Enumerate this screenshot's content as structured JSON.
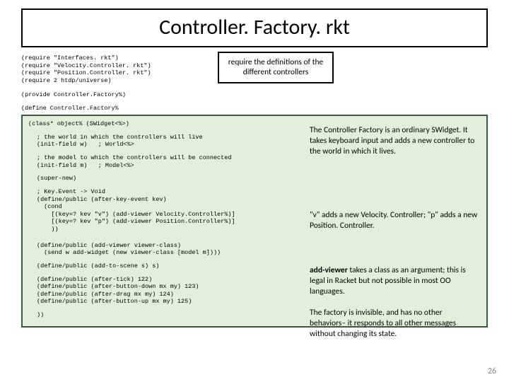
{
  "title": "Controller. Factory. rkt",
  "requires": "(require \"Interfaces. rkt\")\n(require \"Velocity.Controller. rkt\")\n(require \"Position.Controller. rkt\")\n(require 2 htdp/universe)",
  "provide": "(provide Controller.Factory%)",
  "define_open": "(define Controller.Factory%",
  "class_open": "(class* object% (SWidget<%>)",
  "world_comment": "; the world in which the controllers will live\n(init-field w)   ; World<%>",
  "model_comment": "; the model to which the controllers will be connected\n(init-field m)   ; Model<%>",
  "super_new": "(super-new)",
  "key_event": "; Key.Event -> Void\n(define/public (after-key-event kev)\n  (cond\n    [(key=? kev \"v\") (add-viewer Velocity.Controller%)]\n    [(key=? kev \"p\") (add-viewer Position.Controller%)]\n    ))",
  "add_viewer": "(define/public (add-viewer viewer-class)\n  (send w add-widget (new viewer-class [model m])))",
  "add_to_scene": "(define/public (add-to-scene s) s)",
  "afters": "(define/public (after-tick) 122)\n(define/public (after-button-down mx my) 123)\n(define/public (after-drag mx my) 124)\n(define/public (after-button-up mx my) 125)",
  "close": "))",
  "note_requires": "require the definitions of the different controllers",
  "note_factory": "The Controller Factory is an ordinary SWidget. It takes keyboard input and adds a new controller to the world in which it lives.",
  "note_keys": "\"v\" adds a new Velocity. Controller; \"p\" adds a new Position. Controller.",
  "note_addviewer_prefix": "add-viewer",
  "note_addviewer_rest": " takes a class as an argument; this is legal in Racket but not possible in most OO languages.",
  "note_invisible": "The factory is invisible, and has no other behaviors– it responds to all other messages without changing its state.",
  "page_number": "26"
}
